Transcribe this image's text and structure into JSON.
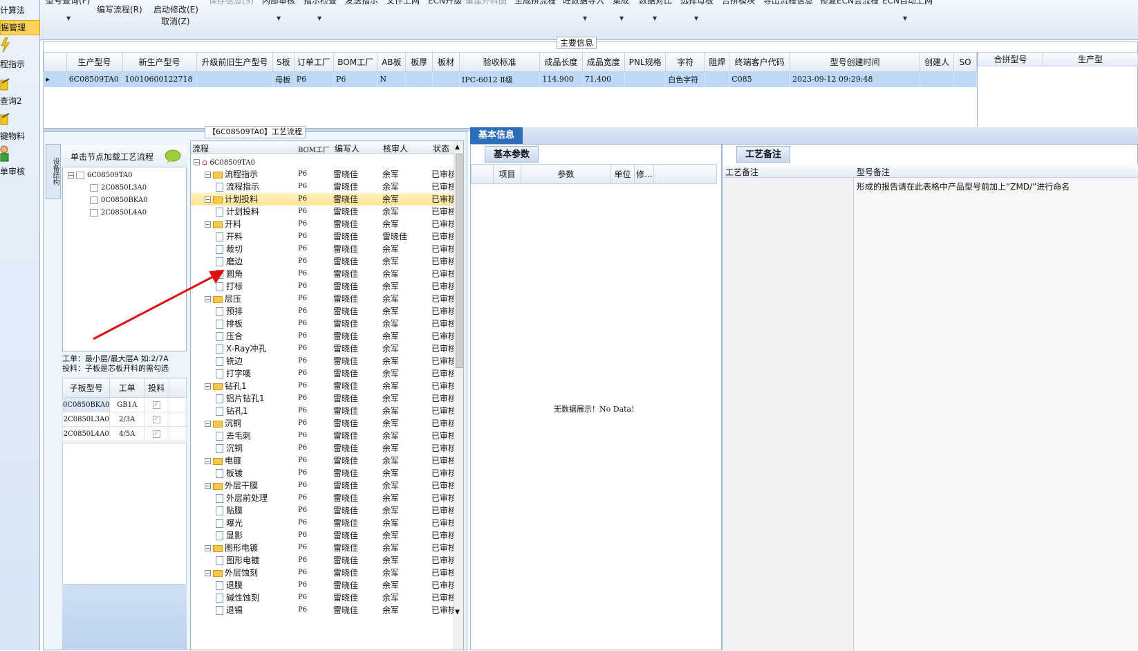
{
  "left_nav": {
    "items": [
      {
        "label": "计算法",
        "selected": false
      },
      {
        "label": "据管理",
        "selected": true
      },
      {
        "label": "程指示",
        "selected": false
      },
      {
        "label": "查询2",
        "selected": false
      },
      {
        "label": "键物料",
        "selected": false
      },
      {
        "label": "单审核",
        "selected": false
      }
    ]
  },
  "toolbar": {
    "items": [
      {
        "label": "型号查询(F)"
      },
      {
        "label": "编写流程(R)"
      },
      {
        "label": "启动修改(E)"
      },
      {
        "label": "取消(Z)"
      },
      {
        "label": "保存信息(S)"
      },
      {
        "label": "内部审核"
      },
      {
        "label": "指示检查"
      },
      {
        "label": "发送指示"
      },
      {
        "label": "文件上网"
      },
      {
        "label": "ECN升级"
      },
      {
        "label": "重建外料图"
      },
      {
        "label": "生成拼流程"
      },
      {
        "label": "旺数据导入"
      },
      {
        "label": "集成"
      },
      {
        "label": "数据对比"
      },
      {
        "label": "选择母板"
      },
      {
        "label": "合拼模块"
      },
      {
        "label": "导出流程信息"
      },
      {
        "label": "修复ECN会流程"
      },
      {
        "label": "ECN自动上网"
      }
    ]
  },
  "main_info": {
    "title": "主要信息",
    "columns": [
      "生产型号",
      "新生产型号",
      "升级前旧生产型号",
      "S板",
      "订单工厂",
      "BOM工厂",
      "AB板",
      "板厚",
      "板材",
      "验收标准",
      "成品长度",
      "成品宽度",
      "PNL规格",
      "字符",
      "阻焊",
      "终端客户代码",
      "型号创建时间",
      "创建人",
      "SO"
    ],
    "row": [
      "6C08509TA0",
      "10010600122718",
      "",
      "母板",
      "P6",
      "P6",
      "N",
      "",
      "",
      "IPC-6012 Ⅱ级",
      "114.900",
      "71.400",
      "",
      "白色字符",
      "",
      "C085",
      "2023-09-12 09:29:48",
      "",
      ""
    ],
    "side_columns": [
      "合拼型号",
      "生产型"
    ]
  },
  "structure": {
    "vtab_label": "设备结构",
    "header": "单击节点加载工艺流程",
    "root": "6C08509TA0",
    "children": [
      "2C0850L3A0",
      "0C0850BKA0",
      "2C0850L4A0"
    ]
  },
  "note": {
    "line1": "工单：最小层/最大层A 如:2/7A",
    "line2": "投料：子板是芯板开料的需勾选"
  },
  "sub_boards": {
    "columns": [
      "子板型号",
      "工单",
      "投料"
    ],
    "rows": [
      {
        "model": "0C0850BKA0",
        "order": "GB1A",
        "checked": true
      },
      {
        "model": "2C0850L3A0",
        "order": "2/3A",
        "checked": true
      },
      {
        "model": "2C0850L4A0",
        "order": "4/5A",
        "checked": true
      }
    ]
  },
  "flow": {
    "title": "【6C08509TA0】工艺流程",
    "columns": [
      "流程",
      "BOM工厂",
      "编写人",
      "核审人",
      "状态"
    ],
    "root": "6C08509TA0",
    "rows": [
      {
        "level": 1,
        "type": "folder",
        "name": "流程指示",
        "bom": "P6",
        "writer": "雷晓佳",
        "reviewer": "余军",
        "status": "已审核"
      },
      {
        "level": 2,
        "type": "doc",
        "name": "流程指示",
        "bom": "P6",
        "writer": "雷晓佳",
        "reviewer": "余军",
        "status": "已审核"
      },
      {
        "level": 1,
        "type": "folder",
        "name": "计划投料",
        "bom": "P6",
        "writer": "雷晓佳",
        "reviewer": "余军",
        "status": "已审核",
        "highlight": true
      },
      {
        "level": 2,
        "type": "doc",
        "name": "计划投料",
        "bom": "P6",
        "writer": "雷晓佳",
        "reviewer": "余军",
        "status": "已审核"
      },
      {
        "level": 1,
        "type": "folder",
        "name": "开料",
        "bom": "P6",
        "writer": "雷晓佳",
        "reviewer": "余军",
        "status": "已审核"
      },
      {
        "level": 2,
        "type": "doc",
        "name": "开料",
        "bom": "P6",
        "writer": "雷晓佳",
        "reviewer": "雷晓佳",
        "status": "已审核"
      },
      {
        "level": 2,
        "type": "doc",
        "name": "裁切",
        "bom": "P6",
        "writer": "雷晓佳",
        "reviewer": "余军",
        "status": "已审核"
      },
      {
        "level": 2,
        "type": "doc",
        "name": "磨边",
        "bom": "P6",
        "writer": "雷晓佳",
        "reviewer": "余军",
        "status": "已审核"
      },
      {
        "level": 2,
        "type": "doc",
        "name": "圆角",
        "bom": "P6",
        "writer": "雷晓佳",
        "reviewer": "余军",
        "status": "已审核"
      },
      {
        "level": 2,
        "type": "doc",
        "name": "打标",
        "bom": "P6",
        "writer": "雷晓佳",
        "reviewer": "余军",
        "status": "已审核"
      },
      {
        "level": 1,
        "type": "folder",
        "name": "层压",
        "bom": "P6",
        "writer": "雷晓佳",
        "reviewer": "余军",
        "status": "已审核"
      },
      {
        "level": 2,
        "type": "doc",
        "name": "预排",
        "bom": "P6",
        "writer": "雷晓佳",
        "reviewer": "余军",
        "status": "已审核"
      },
      {
        "level": 2,
        "type": "doc",
        "name": "排板",
        "bom": "P6",
        "writer": "雷晓佳",
        "reviewer": "余军",
        "status": "已审核"
      },
      {
        "level": 2,
        "type": "doc",
        "name": "压合",
        "bom": "P6",
        "writer": "雷晓佳",
        "reviewer": "余军",
        "status": "已审核"
      },
      {
        "level": 2,
        "type": "doc",
        "name": "X-Ray冲孔",
        "bom": "P6",
        "writer": "雷晓佳",
        "reviewer": "余军",
        "status": "已审核"
      },
      {
        "level": 2,
        "type": "doc",
        "name": "铣边",
        "bom": "P6",
        "writer": "雷晓佳",
        "reviewer": "余军",
        "status": "已审核"
      },
      {
        "level": 2,
        "type": "doc",
        "name": "打字唛",
        "bom": "P6",
        "writer": "雷晓佳",
        "reviewer": "余军",
        "status": "已审核"
      },
      {
        "level": 1,
        "type": "folder",
        "name": "钻孔1",
        "bom": "P6",
        "writer": "雷晓佳",
        "reviewer": "余军",
        "status": "已审核"
      },
      {
        "level": 2,
        "type": "doc",
        "name": "铝片钻孔1",
        "bom": "P6",
        "writer": "雷晓佳",
        "reviewer": "余军",
        "status": "已审核"
      },
      {
        "level": 2,
        "type": "doc",
        "name": "钻孔1",
        "bom": "P6",
        "writer": "雷晓佳",
        "reviewer": "余军",
        "status": "已审核"
      },
      {
        "level": 1,
        "type": "folder",
        "name": "沉铜",
        "bom": "P6",
        "writer": "雷晓佳",
        "reviewer": "余军",
        "status": "已审核"
      },
      {
        "level": 2,
        "type": "doc",
        "name": "去毛刺",
        "bom": "P6",
        "writer": "雷晓佳",
        "reviewer": "余军",
        "status": "已审核"
      },
      {
        "level": 2,
        "type": "doc",
        "name": "沉铜",
        "bom": "P6",
        "writer": "雷晓佳",
        "reviewer": "余军",
        "status": "已审核"
      },
      {
        "level": 1,
        "type": "folder",
        "name": "电镀",
        "bom": "P6",
        "writer": "雷晓佳",
        "reviewer": "余军",
        "status": "已审核"
      },
      {
        "level": 2,
        "type": "doc",
        "name": "板镀",
        "bom": "P6",
        "writer": "雷晓佳",
        "reviewer": "余军",
        "status": "已审核"
      },
      {
        "level": 1,
        "type": "folder",
        "name": "外层干膜",
        "bom": "P6",
        "writer": "雷晓佳",
        "reviewer": "余军",
        "status": "已审核"
      },
      {
        "level": 2,
        "type": "doc",
        "name": "外层前处理",
        "bom": "P6",
        "writer": "雷晓佳",
        "reviewer": "余军",
        "status": "已审核"
      },
      {
        "level": 2,
        "type": "doc",
        "name": "贴膜",
        "bom": "P6",
        "writer": "雷晓佳",
        "reviewer": "余军",
        "status": "已审核"
      },
      {
        "level": 2,
        "type": "doc",
        "name": "曝光",
        "bom": "P6",
        "writer": "雷晓佳",
        "reviewer": "余军",
        "status": "已审核"
      },
      {
        "level": 2,
        "type": "doc",
        "name": "显影",
        "bom": "P6",
        "writer": "雷晓佳",
        "reviewer": "余军",
        "status": "已审核"
      },
      {
        "level": 1,
        "type": "folder",
        "name": "图形电镀",
        "bom": "P6",
        "writer": "雷晓佳",
        "reviewer": "余军",
        "status": "已审核"
      },
      {
        "level": 2,
        "type": "doc",
        "name": "图形电镀",
        "bom": "P6",
        "writer": "雷晓佳",
        "reviewer": "余军",
        "status": "已审核"
      },
      {
        "level": 1,
        "type": "folder",
        "name": "外层蚀刻",
        "bom": "P6",
        "writer": "雷晓佳",
        "reviewer": "余军",
        "status": "已审核"
      },
      {
        "level": 2,
        "type": "doc",
        "name": "退膜",
        "bom": "P6",
        "writer": "雷晓佳",
        "reviewer": "余军",
        "status": "已审核"
      },
      {
        "level": 2,
        "type": "doc",
        "name": "碱性蚀刻",
        "bom": "P6",
        "writer": "雷晓佳",
        "reviewer": "余军",
        "status": "已审核"
      },
      {
        "level": 2,
        "type": "doc",
        "name": "退锡",
        "bom": "P6",
        "writer": "雷晓佳",
        "reviewer": "余军",
        "status": "已审核"
      }
    ]
  },
  "basic_info": {
    "tab": "基本信息",
    "subtab": "基本参数",
    "columns": [
      "项目",
      "参数",
      "单位",
      "修..."
    ],
    "empty_text": "无数据展示！No Data!"
  },
  "craft_notes": {
    "tab": "工艺备注",
    "columns": [
      "工艺备注",
      "型号备注"
    ],
    "model_note": "形成的报告请在此表格中产品型号前加上“ZMD/”进行命名"
  }
}
